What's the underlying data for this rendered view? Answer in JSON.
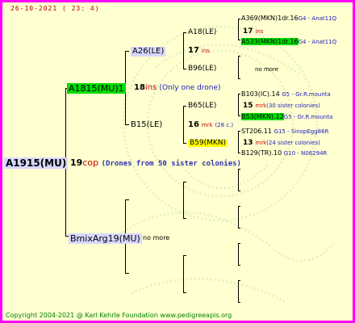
{
  "date": "26-10-2021 ( 23: 4)",
  "root": {
    "name": "A1915(MU)",
    "num": "19",
    "unit": "cop",
    "note": "(Drones from 50 sister colonies)"
  },
  "p1": {
    "name": "A1815(MU)1",
    "num": "18",
    "unit": "ins",
    "note": "(Only one drone)"
  },
  "p2": {
    "name": "BmixArg19(MU)",
    "note": "no more"
  },
  "gp1": {
    "name": "A26(LE)"
  },
  "gp2": {
    "name": "B15(LE)"
  },
  "ggp1": {
    "name": "A18(LE)",
    "num": "17",
    "unit": "ins"
  },
  "ggp2": {
    "name": "B96(LE)",
    "note": "no more"
  },
  "ggp3": {
    "name": "B65(LE)",
    "num": "16",
    "unit": "mrk",
    "note": "(28 c.)"
  },
  "ggp4": {
    "name": "B59(MKN)",
    "num": "13",
    "unit": "mrk",
    "note": "(24 sister colonies)"
  },
  "g1": {
    "name": "A369(MKN)1dr.16",
    "extra": "G4 - Anat11Q"
  },
  "g1b": {
    "num": "17",
    "unit": "ins"
  },
  "g2": {
    "name": "A533(MKN)1dr.16",
    "extra": "G4 - Anat11Q"
  },
  "g3": {
    "name": "B103(IC).14",
    "extra": "G5 - Gr.R.mounta"
  },
  "g3b": {
    "num": "15",
    "unit": "mrk",
    "note": "(30 sister colonies)"
  },
  "g4": {
    "name": "B53(MKN).12",
    "extra": "G5 - Gr.R.mounta"
  },
  "g5": {
    "name": "ST206.11",
    "extra": "G15 - SinopEgg86R"
  },
  "g5b": {
    "num": "13",
    "unit": "mrk",
    "note": "(24 sister colonies)"
  },
  "g6": {
    "name": "B129(TR).10",
    "extra": "G10 - N06294R"
  },
  "footer": "Copyright 2004-2021 @ Karl Kehrle Foundation    www.pedigreeapis.org",
  "colors": {
    "frame": "#ff00ff",
    "background": "#ffffd0",
    "highlight_green": "#00dd00",
    "highlight_yellow": "#ffff00",
    "highlight_blue": "#d8d8ff"
  }
}
